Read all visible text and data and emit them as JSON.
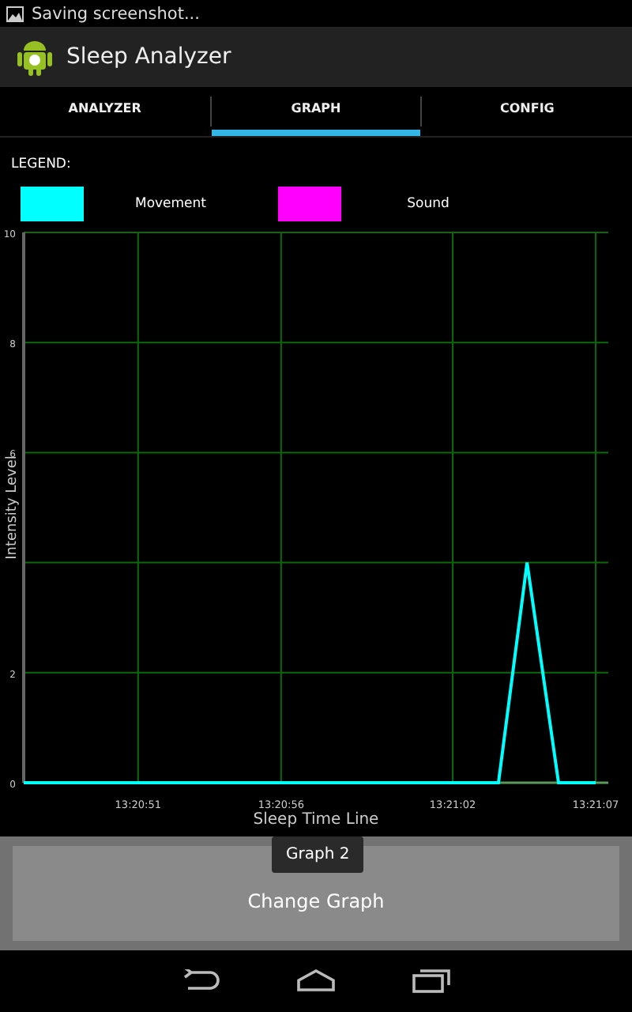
{
  "status_bar": {
    "notification": "Saving screenshot..."
  },
  "action_bar": {
    "title": "Sleep Analyzer"
  },
  "tabs": [
    {
      "label": "ANALYZER",
      "selected": false
    },
    {
      "label": "GRAPH",
      "selected": true
    },
    {
      "label": "CONFIG",
      "selected": false
    }
  ],
  "legend_title": "LEGEND:",
  "chart_data": {
    "type": "line",
    "xlabel": "Sleep Time Line",
    "ylabel": "Intensity Level",
    "grid": true,
    "xlim": [
      48047,
      48067.44
    ],
    "ylim": [
      0,
      10
    ],
    "x": [
      48047,
      48048,
      48049,
      48050,
      48051,
      48052,
      48053,
      48054,
      48055,
      48056,
      48057,
      48058,
      48059,
      48060,
      48061,
      48062,
      48063,
      48063.6,
      48064.6,
      48065.7,
      48067
    ],
    "series": [
      {
        "name": "Movement",
        "color": "#00ffff",
        "values": [
          0,
          0,
          0,
          0,
          0,
          0,
          0,
          0,
          0,
          0,
          0,
          0,
          0,
          0,
          0,
          0,
          0,
          0,
          4,
          0,
          0
        ]
      },
      {
        "name": "Sound",
        "color": "#ff00ff",
        "values": [
          null,
          null,
          null,
          null,
          null,
          null,
          null,
          null,
          null,
          null,
          null,
          null,
          null,
          null,
          null,
          null,
          null,
          null,
          null,
          null,
          null
        ]
      }
    ],
    "xticks": [
      {
        "value": 48051,
        "label": "13:20:51"
      },
      {
        "value": 48056,
        "label": "13:20:56"
      },
      {
        "value": 48062,
        "label": "13:21:02"
      },
      {
        "value": 48067,
        "label": "13:21:07"
      }
    ],
    "yticks": [
      0,
      2,
      6,
      8,
      10
    ]
  },
  "toast": "Graph 2",
  "button": "Change Graph"
}
